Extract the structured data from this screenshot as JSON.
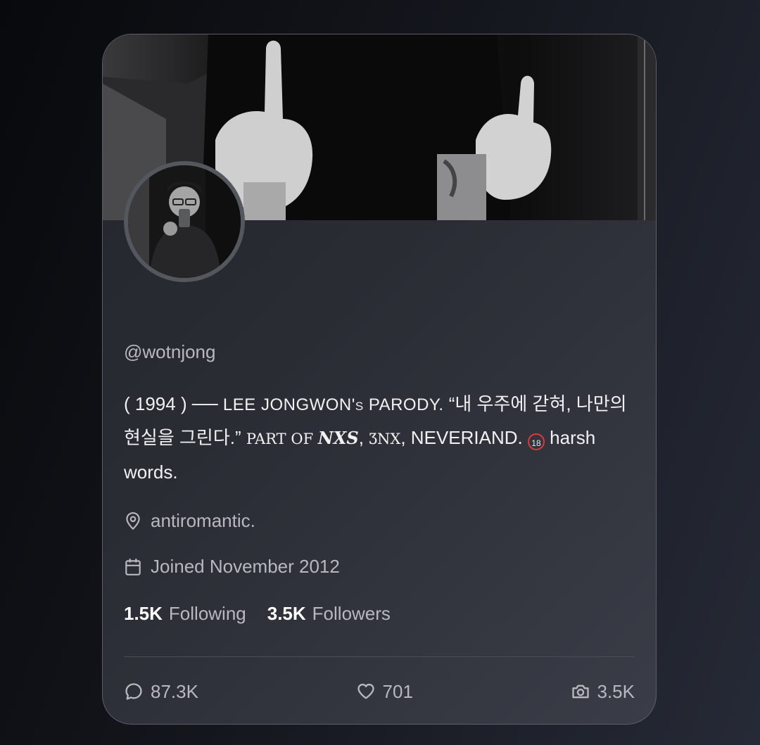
{
  "profile": {
    "handle": "@wotnjong",
    "bio": {
      "part1": "( 1994 ) ── ",
      "part2_smallcaps": "LEE JONGWON's PARODY.",
      "part3": " “내 우주에 갇혀, 나만의 현실을 그린다.” ",
      "part4_serif": "PART OF ",
      "part5_italic": "NXS",
      "part6": ", ",
      "part7_styled": "ƷNX",
      "part8": ", NEVERIAND. ",
      "badge": "18",
      "part9": " harsh words."
    },
    "location": "antiromantic.",
    "joined": "Joined November 2012"
  },
  "stats": {
    "following_count": "1.5K",
    "following_label": "Following",
    "followers_count": "3.5K",
    "followers_label": "Followers"
  },
  "actions": {
    "replies": "87.3K",
    "likes": "701",
    "media": "3.5K"
  },
  "icons": {
    "location": "map-pin-icon",
    "joined": "calendar-icon",
    "replies": "speech-bubble-icon",
    "likes": "heart-icon",
    "media": "camera-icon"
  },
  "colors": {
    "badge_red": "#e0383b",
    "muted_text": "#b7b9bf"
  }
}
